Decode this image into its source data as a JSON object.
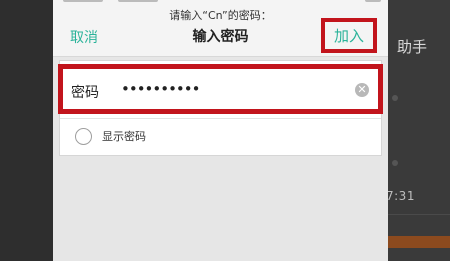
{
  "dialog": {
    "subtitle": "请输入“Cn”的密码：",
    "title": "输入密码",
    "cancel_label": "取消",
    "join_label": "加入"
  },
  "password": {
    "label": "密码",
    "value": "••••••••••"
  },
  "show_password": {
    "label": "显示密码",
    "checked": false
  },
  "background_app": {
    "fragment_text": "助手",
    "time_fragment": "7:31"
  },
  "colors": {
    "accent": "#2bb39a",
    "highlight": "#c2141c"
  }
}
